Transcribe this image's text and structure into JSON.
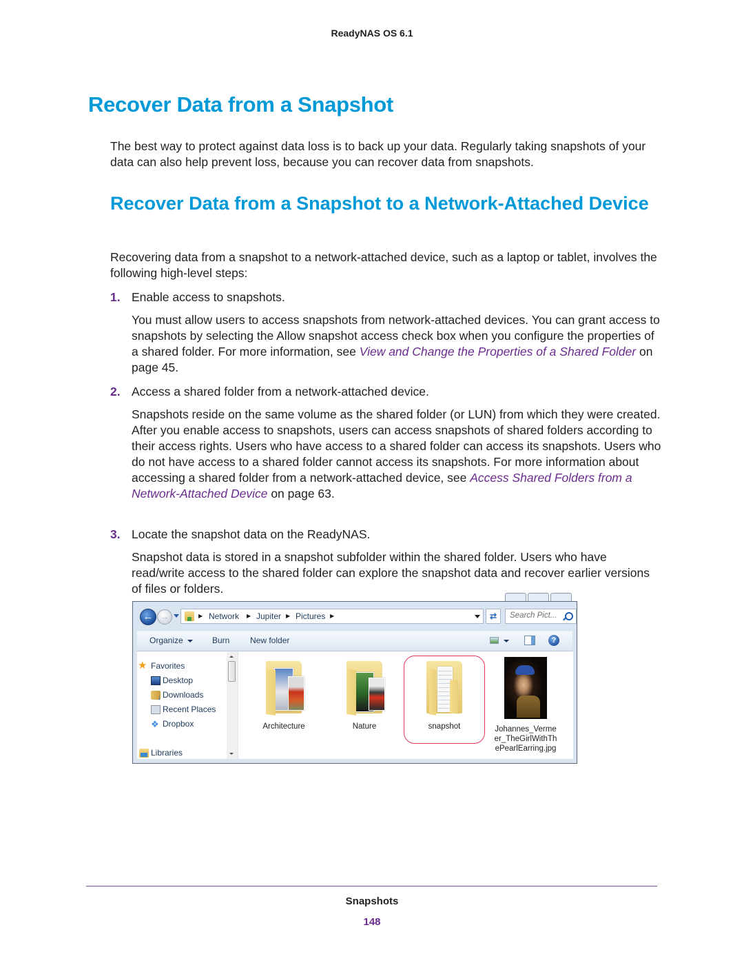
{
  "header": {
    "running_title": "ReadyNAS OS 6.1"
  },
  "section": {
    "title": "Recover Data from a Snapshot",
    "intro": "The best way to protect against data loss is to back up your data. Regularly taking snapshots of your data can also help prevent loss, because you can recover data from snapshots."
  },
  "subsection": {
    "title": "Recover Data from a Snapshot to a Network-Attached Device",
    "intro": "Recovering data from a snapshot to a network-attached device, such as a laptop or tablet, involves the following high-level steps:",
    "steps": [
      {
        "number": "1.",
        "title": "Enable access to snapshots.",
        "body_before": "You must allow users to access snapshots from network-attached devices. You can grant access to snapshots by selecting the Allow snapshot access check box when you configure the properties of a shared folder. For more information, see ",
        "link": "View and Change the Properties of a Shared Folder",
        "body_after": " on page 45."
      },
      {
        "number": "2.",
        "title": "Access a shared folder from a network-attached device.",
        "body_before": "Snapshots reside on the same volume as the shared folder (or LUN) from which they were created. After you enable access to snapshots, users can access snapshots of shared folders according to their access rights. Users who have access to a shared folder can access its snapshots. Users who do not have access to a shared folder cannot access its snapshots. For more information about accessing a shared folder from a network-attached device, see ",
        "link": "Access Shared Folders from a Network-Attached Device",
        "body_after": " on page 63."
      },
      {
        "number": "3.",
        "title": "Locate the snapshot data on the ReadyNAS.",
        "body": "Snapshot data is stored in a snapshot subfolder within the shared folder. Users who have read/write access to the shared folder can explore the snapshot data and recover earlier versions of files or folders."
      }
    ]
  },
  "explorer": {
    "breadcrumbs": [
      "Network",
      "Jupiter",
      "Pictures"
    ],
    "search_placeholder": "Search Pict...",
    "toolbar": {
      "organize": "Organize",
      "burn": "Burn",
      "new_folder": "New folder"
    },
    "nav": {
      "favorites": "Favorites",
      "items": [
        "Desktop",
        "Downloads",
        "Recent Places",
        "Dropbox"
      ],
      "libraries": "Libraries"
    },
    "files": [
      {
        "name": "Architecture",
        "type": "folder"
      },
      {
        "name": "Nature",
        "type": "folder"
      },
      {
        "name": "snapshot",
        "type": "folder",
        "highlighted": true
      },
      {
        "name": "Johannes_Vermeer_TheGirlWithThePearlEarring.jpg",
        "type": "image",
        "label_lines": [
          "Johannes_Verme",
          "er_TheGirlWithTh",
          "ePearlEarring.jpg"
        ]
      }
    ],
    "highlight_color": "#e0355a"
  },
  "footer": {
    "chapter": "Snapshots",
    "page": "148"
  },
  "colors": {
    "heading": "#0099d8",
    "accent": "#6a2c8e",
    "text": "#231f20"
  }
}
